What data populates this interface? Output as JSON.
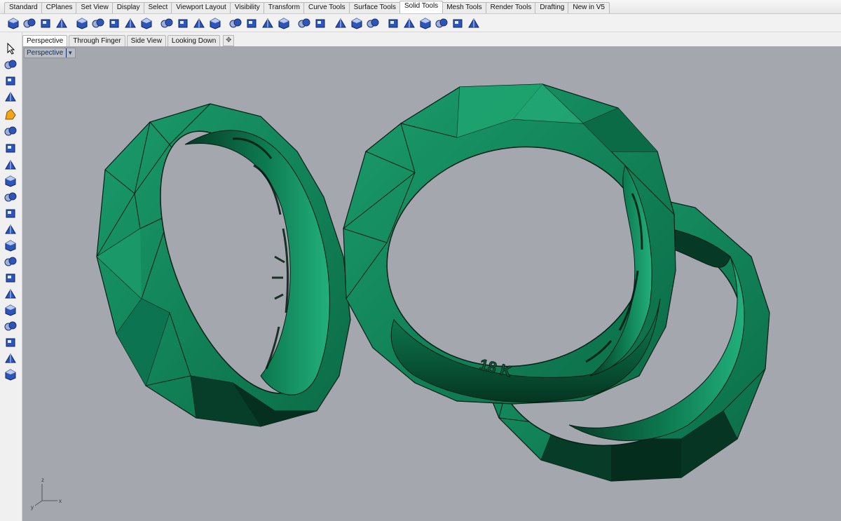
{
  "toolbar_tabs": [
    "Standard",
    "CPlanes",
    "Set View",
    "Display",
    "Select",
    "Viewport Layout",
    "Visibility",
    "Transform",
    "Curve Tools",
    "Surface Tools",
    "Solid Tools",
    "Mesh Tools",
    "Render Tools",
    "Drafting",
    "New in V5"
  ],
  "active_toolbar_tab": "Solid Tools",
  "solid_tool_icons": [
    "boolean-union-icon",
    "boolean-difference-icon",
    "boolean-intersection-icon",
    "boolean-split-icon",
    "cap-planar-holes-icon",
    "extract-surface-icon",
    "merge-faces-icon",
    "fillet-edges-icon",
    "chamfer-edges-icon",
    "blend-edge-icon",
    "move-face-icon",
    "extrude-face-icon",
    "split-face-icon",
    "move-edge-icon",
    "shell-icon",
    "offset-surface-icon",
    "wire-cut-icon",
    "solid-box-icon",
    "solid-sphere-icon",
    "make-hole-icon",
    "move-hole-icon",
    "rotate-hole-icon",
    "array-hole-icon",
    "round-hole-icon",
    "text-object-icon",
    "create-solid-icon",
    "mesh-grid-icon",
    "delete-hole-icon"
  ],
  "viewport_tabs": [
    "Perspective",
    "Through Finger",
    "Side View",
    "Looking Down"
  ],
  "active_viewport_tab": "Perspective",
  "viewport_title": "Perspective",
  "left_tool_icons": [
    "select-arrow-icon",
    "point-icon",
    "polyline-icon",
    "curve-icon",
    "surface-icon",
    "solid-box-icon",
    "solid-box-2-icon",
    "sphere-icon",
    "ellipsoid-icon",
    "torus-icon",
    "paraboloid-icon",
    "cone-icon",
    "truncated-cone-icon",
    "pyramid-icon",
    "tetrahedron-icon",
    "cylinder-icon",
    "tube-icon",
    "pipe-icon",
    "extrude-curve-icon",
    "revolve-icon",
    "rail-revolve-icon"
  ],
  "engraving_text": "18 K",
  "axis": {
    "x": "x",
    "y": "y",
    "z": "z"
  },
  "colors": {
    "viewport_bg": "#a4a8ae",
    "ring_green": "#0f7d55",
    "ring_dark": "#063f2a",
    "ring_light": "#1fa170",
    "icon_blue": "#2e56b8"
  }
}
